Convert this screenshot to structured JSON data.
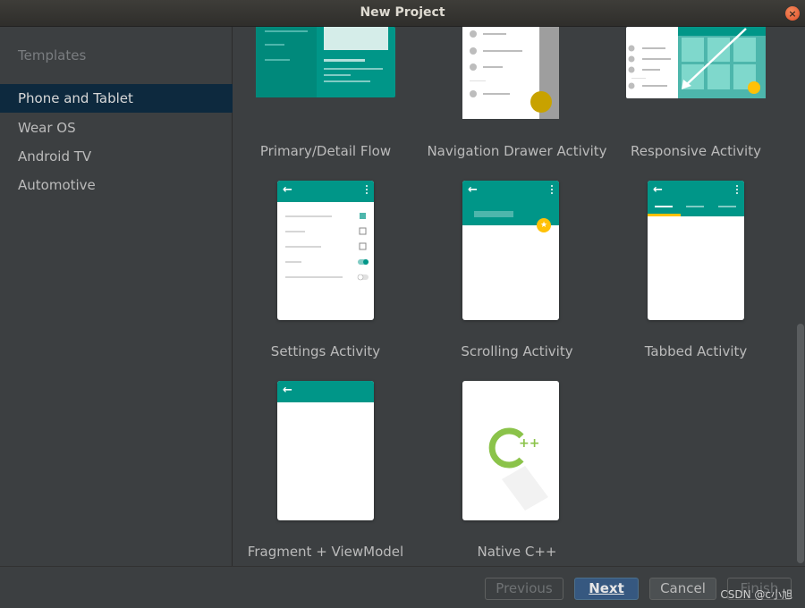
{
  "window": {
    "title": "New Project",
    "close_icon": "close-icon"
  },
  "sidebar": {
    "heading": "Templates",
    "items": [
      {
        "label": "Phone and Tablet",
        "selected": true
      },
      {
        "label": "Wear OS",
        "selected": false
      },
      {
        "label": "Android TV",
        "selected": false
      },
      {
        "label": "Automotive",
        "selected": false
      }
    ]
  },
  "templates": [
    {
      "label": "Primary/Detail Flow"
    },
    {
      "label": "Navigation Drawer Activity"
    },
    {
      "label": "Responsive Activity"
    },
    {
      "label": "Settings Activity"
    },
    {
      "label": "Scrolling Activity"
    },
    {
      "label": "Tabbed Activity"
    },
    {
      "label": "Fragment + ViewModel"
    },
    {
      "label": "Native C++",
      "logo_text": "++"
    }
  ],
  "footer": {
    "previous_label": "Previous",
    "next_label": "Next",
    "cancel_label": "Cancel",
    "finish_label": "Finish",
    "watermark": "CSDN @c小旭"
  },
  "colors": {
    "accent": "#009688",
    "fab": "#ffc107",
    "cpp_green": "#7cb342",
    "selection": "#0d293e"
  }
}
